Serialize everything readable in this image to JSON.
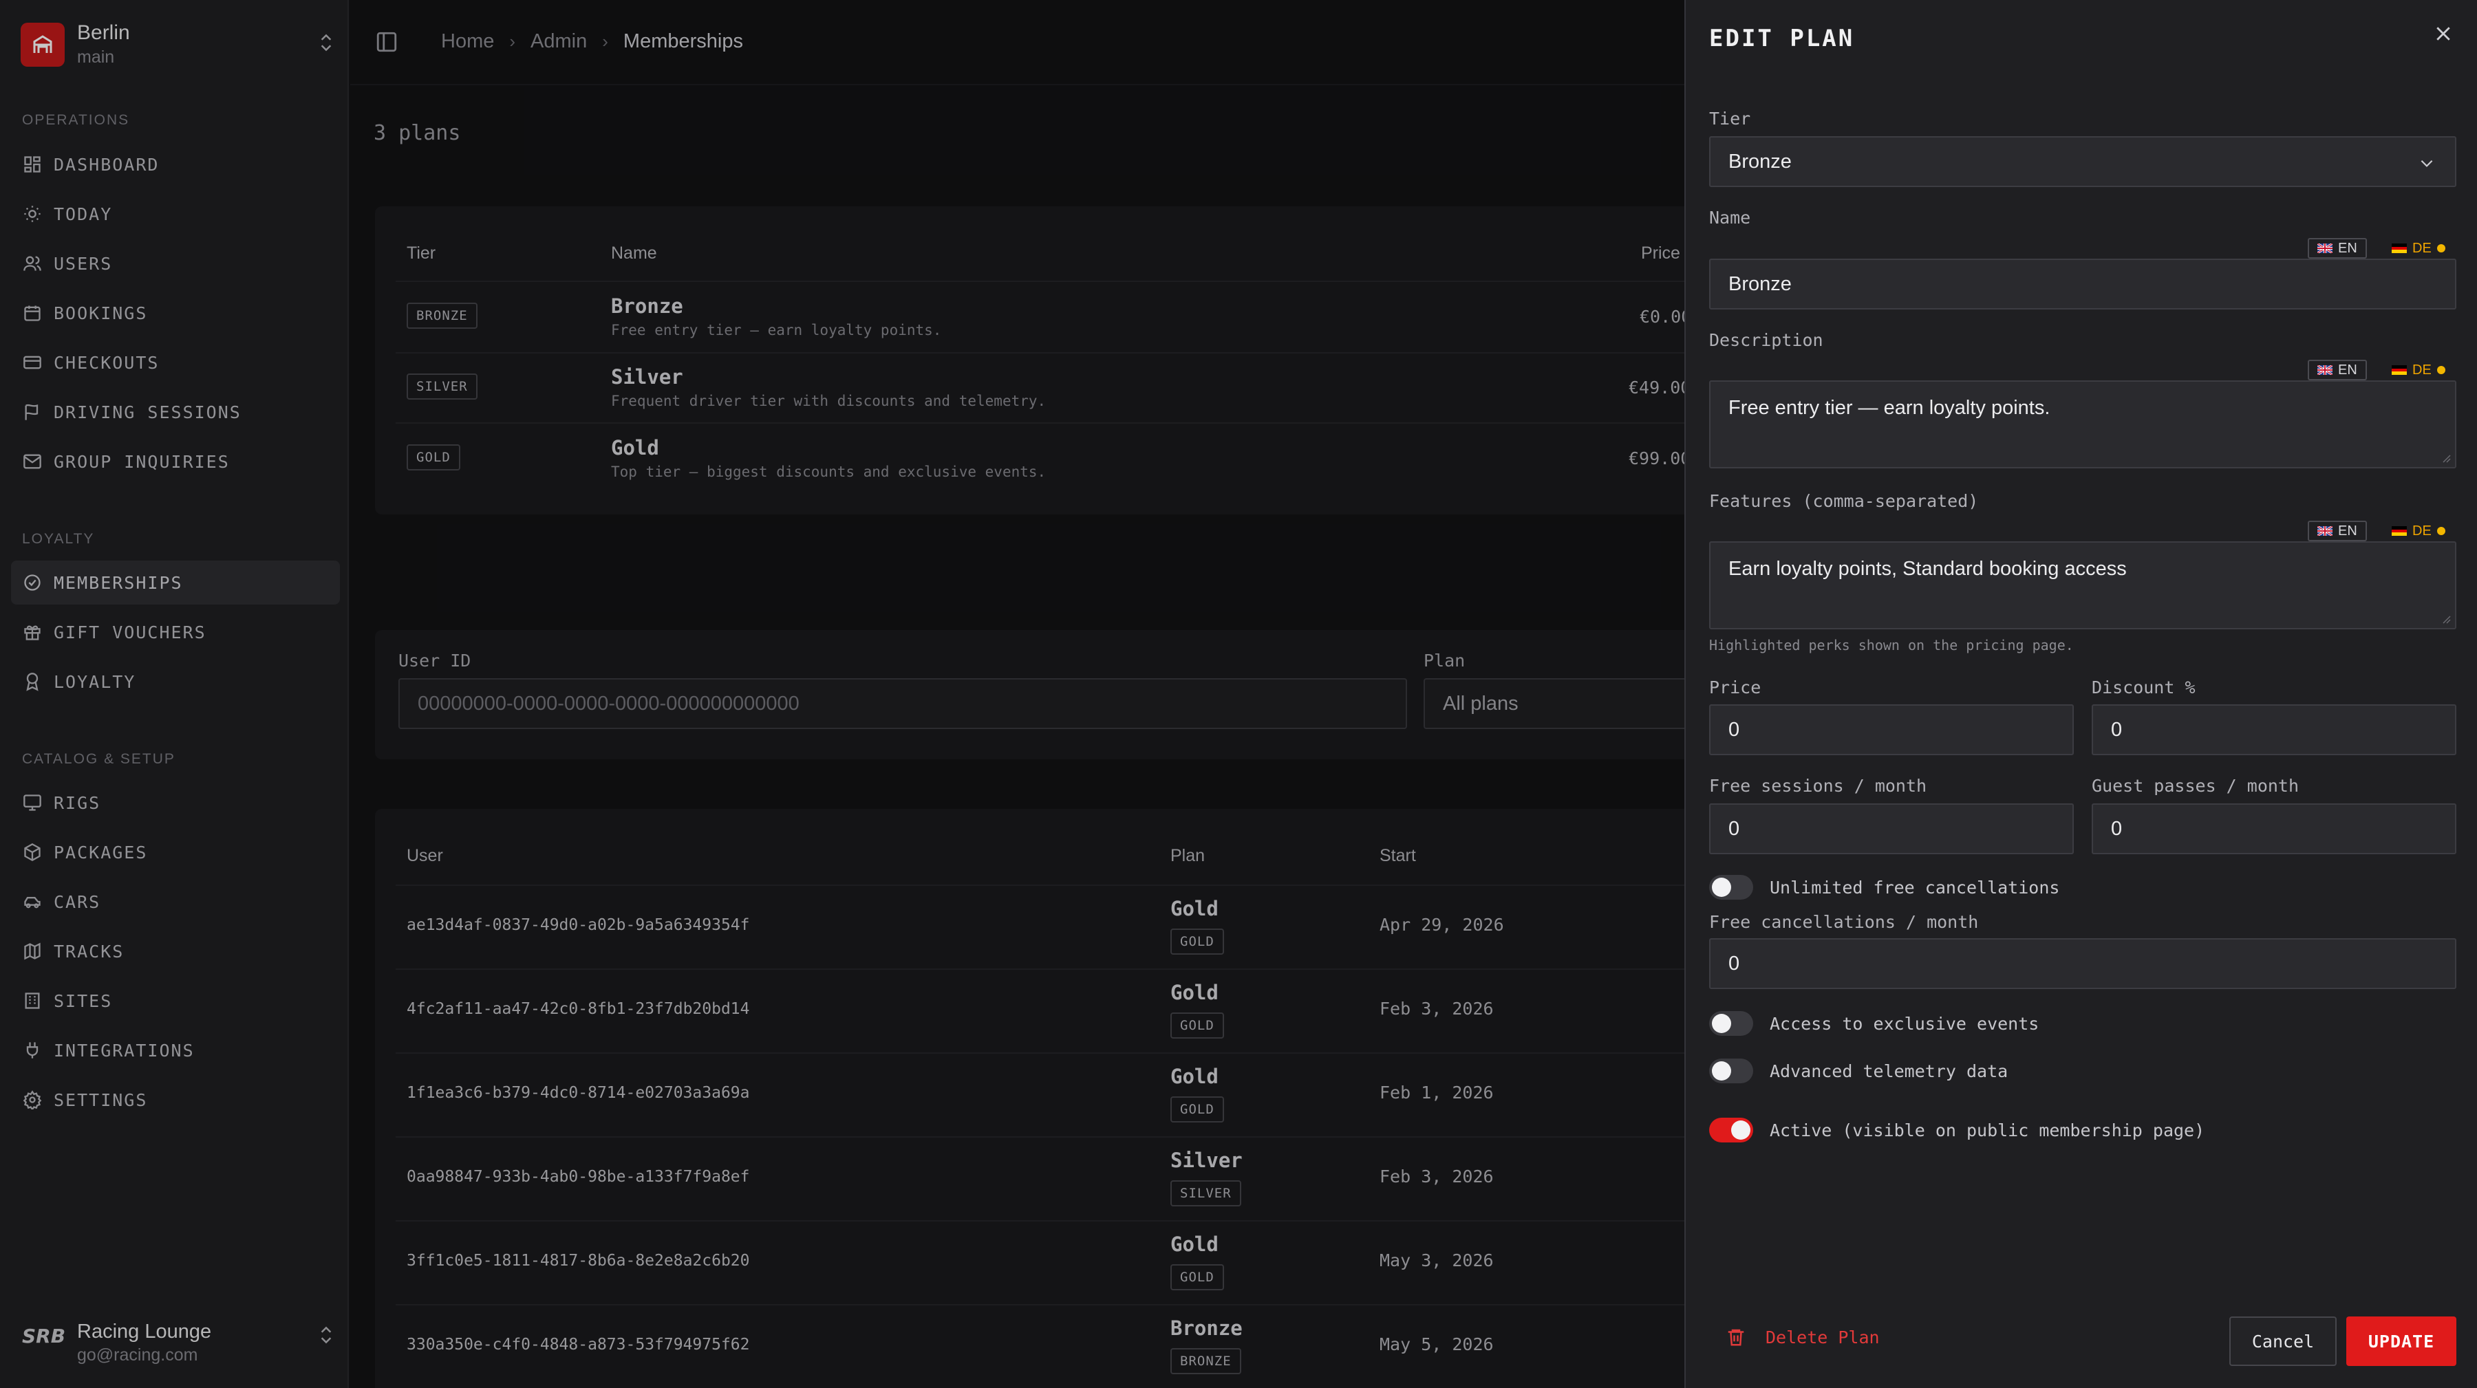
{
  "site": {
    "name": "Berlin",
    "branch": "main"
  },
  "nav": {
    "sections": {
      "operations": "OPERATIONS",
      "loyalty": "LOYALTY",
      "catalog": "CATALOG & SETUP"
    },
    "items": {
      "dashboard": "DASHBOARD",
      "today": "TODAY",
      "users": "USERS",
      "bookings": "BOOKINGS",
      "checkouts": "CHECKOUTS",
      "driving_sessions": "DRIVING SESSIONS",
      "group_inquiries": "GROUP INQUIRIES",
      "memberships": "MEMBERSHIPS",
      "gift_vouchers": "GIFT VOUCHERS",
      "loyalty": "LOYALTY",
      "rigs": "RIGS",
      "packages": "PACKAGES",
      "cars": "CARS",
      "tracks": "TRACKS",
      "sites": "SITES",
      "integrations": "INTEGRATIONS",
      "settings": "SETTINGS"
    }
  },
  "account": {
    "name": "Racing Lounge",
    "email": "go@racing.com"
  },
  "breadcrumb": {
    "home": "Home",
    "admin": "Admin",
    "current": "Memberships"
  },
  "plans_count": "3 plans",
  "plans_table": {
    "headers": {
      "tier": "Tier",
      "name": "Name",
      "price": "Price"
    },
    "rows": [
      {
        "badge": "BRONZE",
        "name": "Bronze",
        "desc": "Free entry tier — earn loyalty points.",
        "price": "€0.00"
      },
      {
        "badge": "SILVER",
        "name": "Silver",
        "desc": "Frequent driver tier with discounts and telemetry.",
        "price": "€49.00"
      },
      {
        "badge": "GOLD",
        "name": "Gold",
        "desc": "Top tier — biggest discounts and exclusive events.",
        "price": "€99.00"
      }
    ]
  },
  "filters": {
    "user_id_label": "User ID",
    "user_id_placeholder": "00000000-0000-0000-0000-000000000000",
    "plan_label": "Plan",
    "plan_value": "All plans"
  },
  "members_table": {
    "headers": {
      "user": "User",
      "plan": "Plan",
      "start": "Start"
    },
    "rows": [
      {
        "user": "ae13d4af-0837-49d0-a02b-9a5a6349354f",
        "plan": "Gold",
        "badge": "GOLD",
        "start": "Apr 29, 2026"
      },
      {
        "user": "4fc2af11-aa47-42c0-8fb1-23f7db20bd14",
        "plan": "Gold",
        "badge": "GOLD",
        "start": "Feb 3, 2026"
      },
      {
        "user": "1f1ea3c6-b379-4dc0-8714-e02703a3a69a",
        "plan": "Gold",
        "badge": "GOLD",
        "start": "Feb 1, 2026"
      },
      {
        "user": "0aa98847-933b-4ab0-98be-a133f7f9a8ef",
        "plan": "Silver",
        "badge": "SILVER",
        "start": "Feb 3, 2026"
      },
      {
        "user": "3ff1c0e5-1811-4817-8b6a-8e2e8a2c6b20",
        "plan": "Gold",
        "badge": "GOLD",
        "start": "May 3, 2026"
      },
      {
        "user": "330a350e-c4f0-4848-a873-53f794975f62",
        "plan": "Bronze",
        "badge": "BRONZE",
        "start": "May 5, 2026"
      }
    ]
  },
  "drawer": {
    "title": "EDIT PLAN",
    "tier_label": "Tier",
    "tier_value": "Bronze",
    "name_label": "Name",
    "name_value": "Bronze",
    "description_label": "Description",
    "description_value": "Free entry tier — earn loyalty points.",
    "features_label": "Features (comma-separated)",
    "features_value": "Earn loyalty points, Standard booking access",
    "features_hint": "Highlighted perks shown on the pricing page.",
    "lang_en": "EN",
    "lang_de": "DE",
    "price_label": "Price",
    "price_value": "0",
    "discount_label": "Discount %",
    "discount_value": "0",
    "free_sessions_label": "Free sessions / month",
    "free_sessions_value": "0",
    "guest_passes_label": "Guest passes / month",
    "guest_passes_value": "0",
    "unlimited_cancel_label": "Unlimited free cancellations",
    "unlimited_cancel_on": false,
    "free_cancel_label": "Free cancellations / month",
    "free_cancel_value": "0",
    "exclusive_events_label": "Access to exclusive events",
    "exclusive_events_on": false,
    "telemetry_label": "Advanced telemetry data",
    "telemetry_on": false,
    "active_label": "Active (visible on public membership page)",
    "active_on": true,
    "delete_label": "Delete Plan",
    "cancel_label": "Cancel",
    "update_label": "UPDATE"
  },
  "colors": {
    "accent": "#e01b1b",
    "brand": "#c41a1a",
    "de_dot": "#f2b600"
  }
}
